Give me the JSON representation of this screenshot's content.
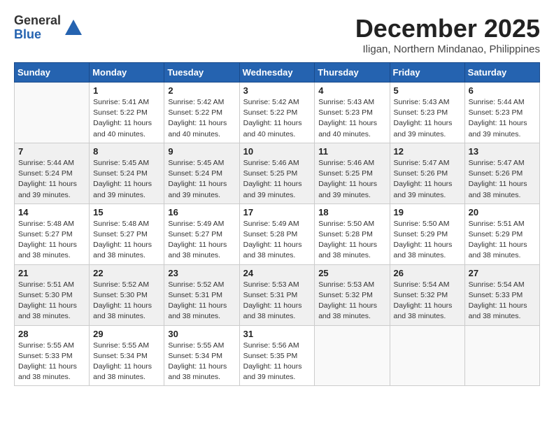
{
  "logo": {
    "general": "General",
    "blue": "Blue"
  },
  "title": "December 2025",
  "location": "Iligan, Northern Mindanao, Philippines",
  "days_of_week": [
    "Sunday",
    "Monday",
    "Tuesday",
    "Wednesday",
    "Thursday",
    "Friday",
    "Saturday"
  ],
  "weeks": [
    [
      {
        "day": "",
        "sunrise": "",
        "sunset": "",
        "daylight": ""
      },
      {
        "day": "1",
        "sunrise": "Sunrise: 5:41 AM",
        "sunset": "Sunset: 5:22 PM",
        "daylight": "Daylight: 11 hours and 40 minutes."
      },
      {
        "day": "2",
        "sunrise": "Sunrise: 5:42 AM",
        "sunset": "Sunset: 5:22 PM",
        "daylight": "Daylight: 11 hours and 40 minutes."
      },
      {
        "day": "3",
        "sunrise": "Sunrise: 5:42 AM",
        "sunset": "Sunset: 5:22 PM",
        "daylight": "Daylight: 11 hours and 40 minutes."
      },
      {
        "day": "4",
        "sunrise": "Sunrise: 5:43 AM",
        "sunset": "Sunset: 5:23 PM",
        "daylight": "Daylight: 11 hours and 40 minutes."
      },
      {
        "day": "5",
        "sunrise": "Sunrise: 5:43 AM",
        "sunset": "Sunset: 5:23 PM",
        "daylight": "Daylight: 11 hours and 39 minutes."
      },
      {
        "day": "6",
        "sunrise": "Sunrise: 5:44 AM",
        "sunset": "Sunset: 5:23 PM",
        "daylight": "Daylight: 11 hours and 39 minutes."
      }
    ],
    [
      {
        "day": "7",
        "sunrise": "Sunrise: 5:44 AM",
        "sunset": "Sunset: 5:24 PM",
        "daylight": "Daylight: 11 hours and 39 minutes."
      },
      {
        "day": "8",
        "sunrise": "Sunrise: 5:45 AM",
        "sunset": "Sunset: 5:24 PM",
        "daylight": "Daylight: 11 hours and 39 minutes."
      },
      {
        "day": "9",
        "sunrise": "Sunrise: 5:45 AM",
        "sunset": "Sunset: 5:24 PM",
        "daylight": "Daylight: 11 hours and 39 minutes."
      },
      {
        "day": "10",
        "sunrise": "Sunrise: 5:46 AM",
        "sunset": "Sunset: 5:25 PM",
        "daylight": "Daylight: 11 hours and 39 minutes."
      },
      {
        "day": "11",
        "sunrise": "Sunrise: 5:46 AM",
        "sunset": "Sunset: 5:25 PM",
        "daylight": "Daylight: 11 hours and 39 minutes."
      },
      {
        "day": "12",
        "sunrise": "Sunrise: 5:47 AM",
        "sunset": "Sunset: 5:26 PM",
        "daylight": "Daylight: 11 hours and 39 minutes."
      },
      {
        "day": "13",
        "sunrise": "Sunrise: 5:47 AM",
        "sunset": "Sunset: 5:26 PM",
        "daylight": "Daylight: 11 hours and 38 minutes."
      }
    ],
    [
      {
        "day": "14",
        "sunrise": "Sunrise: 5:48 AM",
        "sunset": "Sunset: 5:27 PM",
        "daylight": "Daylight: 11 hours and 38 minutes."
      },
      {
        "day": "15",
        "sunrise": "Sunrise: 5:48 AM",
        "sunset": "Sunset: 5:27 PM",
        "daylight": "Daylight: 11 hours and 38 minutes."
      },
      {
        "day": "16",
        "sunrise": "Sunrise: 5:49 AM",
        "sunset": "Sunset: 5:27 PM",
        "daylight": "Daylight: 11 hours and 38 minutes."
      },
      {
        "day": "17",
        "sunrise": "Sunrise: 5:49 AM",
        "sunset": "Sunset: 5:28 PM",
        "daylight": "Daylight: 11 hours and 38 minutes."
      },
      {
        "day": "18",
        "sunrise": "Sunrise: 5:50 AM",
        "sunset": "Sunset: 5:28 PM",
        "daylight": "Daylight: 11 hours and 38 minutes."
      },
      {
        "day": "19",
        "sunrise": "Sunrise: 5:50 AM",
        "sunset": "Sunset: 5:29 PM",
        "daylight": "Daylight: 11 hours and 38 minutes."
      },
      {
        "day": "20",
        "sunrise": "Sunrise: 5:51 AM",
        "sunset": "Sunset: 5:29 PM",
        "daylight": "Daylight: 11 hours and 38 minutes."
      }
    ],
    [
      {
        "day": "21",
        "sunrise": "Sunrise: 5:51 AM",
        "sunset": "Sunset: 5:30 PM",
        "daylight": "Daylight: 11 hours and 38 minutes."
      },
      {
        "day": "22",
        "sunrise": "Sunrise: 5:52 AM",
        "sunset": "Sunset: 5:30 PM",
        "daylight": "Daylight: 11 hours and 38 minutes."
      },
      {
        "day": "23",
        "sunrise": "Sunrise: 5:52 AM",
        "sunset": "Sunset: 5:31 PM",
        "daylight": "Daylight: 11 hours and 38 minutes."
      },
      {
        "day": "24",
        "sunrise": "Sunrise: 5:53 AM",
        "sunset": "Sunset: 5:31 PM",
        "daylight": "Daylight: 11 hours and 38 minutes."
      },
      {
        "day": "25",
        "sunrise": "Sunrise: 5:53 AM",
        "sunset": "Sunset: 5:32 PM",
        "daylight": "Daylight: 11 hours and 38 minutes."
      },
      {
        "day": "26",
        "sunrise": "Sunrise: 5:54 AM",
        "sunset": "Sunset: 5:32 PM",
        "daylight": "Daylight: 11 hours and 38 minutes."
      },
      {
        "day": "27",
        "sunrise": "Sunrise: 5:54 AM",
        "sunset": "Sunset: 5:33 PM",
        "daylight": "Daylight: 11 hours and 38 minutes."
      }
    ],
    [
      {
        "day": "28",
        "sunrise": "Sunrise: 5:55 AM",
        "sunset": "Sunset: 5:33 PM",
        "daylight": "Daylight: 11 hours and 38 minutes."
      },
      {
        "day": "29",
        "sunrise": "Sunrise: 5:55 AM",
        "sunset": "Sunset: 5:34 PM",
        "daylight": "Daylight: 11 hours and 38 minutes."
      },
      {
        "day": "30",
        "sunrise": "Sunrise: 5:55 AM",
        "sunset": "Sunset: 5:34 PM",
        "daylight": "Daylight: 11 hours and 38 minutes."
      },
      {
        "day": "31",
        "sunrise": "Sunrise: 5:56 AM",
        "sunset": "Sunset: 5:35 PM",
        "daylight": "Daylight: 11 hours and 39 minutes."
      },
      {
        "day": "",
        "sunrise": "",
        "sunset": "",
        "daylight": ""
      },
      {
        "day": "",
        "sunrise": "",
        "sunset": "",
        "daylight": ""
      },
      {
        "day": "",
        "sunrise": "",
        "sunset": "",
        "daylight": ""
      }
    ]
  ]
}
